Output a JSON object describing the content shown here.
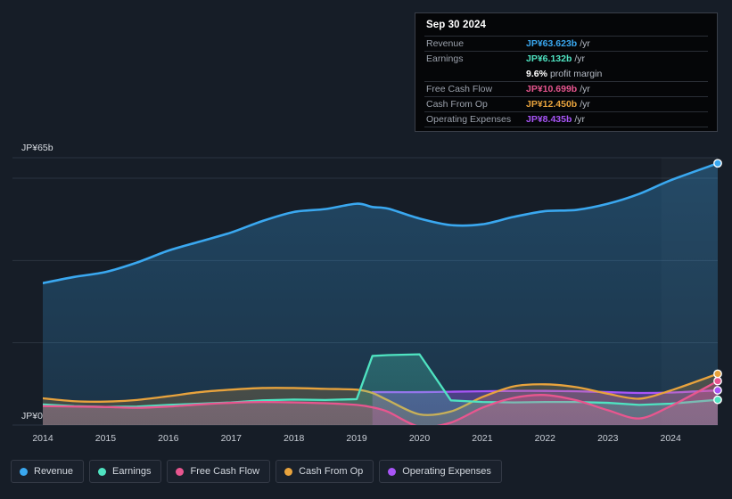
{
  "tooltip": {
    "date": "Sep 30 2024",
    "rows": [
      {
        "label": "Revenue",
        "value": "JP¥63.623b",
        "unit": "/yr",
        "color": "#3aa8f0"
      },
      {
        "label": "Earnings",
        "value": "JP¥6.132b",
        "unit": "/yr",
        "color": "#4fe3c1"
      },
      {
        "label": "Free Cash Flow",
        "value": "JP¥10.699b",
        "unit": "/yr",
        "color": "#e8568f"
      },
      {
        "label": "Cash From Op",
        "value": "JP¥12.450b",
        "unit": "/yr",
        "color": "#e8a33d"
      },
      {
        "label": "Operating Expenses",
        "value": "JP¥8.435b",
        "unit": "/yr",
        "color": "#a855f7"
      }
    ],
    "margin_value": "9.6%",
    "margin_text": "profit margin"
  },
  "axis": {
    "y_top_label": "JP¥65b",
    "y_zero_label": "JP¥0"
  },
  "legend": [
    {
      "label": "Revenue",
      "color": "#3aa8f0"
    },
    {
      "label": "Earnings",
      "color": "#4fe3c1"
    },
    {
      "label": "Free Cash Flow",
      "color": "#e8568f"
    },
    {
      "label": "Cash From Op",
      "color": "#e8a33d"
    },
    {
      "label": "Operating Expenses",
      "color": "#a855f7"
    }
  ],
  "chart_data": {
    "type": "area",
    "title": "",
    "xlabel": "",
    "ylabel": "JP¥",
    "ylim": [
      -2,
      65
    ],
    "yticks": [
      0,
      20,
      40,
      60,
      65
    ],
    "ytick_labels": [
      "JP¥0",
      "",
      "",
      "",
      "JP¥65b"
    ],
    "grid": true,
    "legend_position": "bottom-left",
    "currency": "JP¥",
    "units": "billions per year",
    "categories": [
      "2014",
      "2015",
      "2016",
      "2017",
      "2018",
      "2019",
      "2020",
      "2021",
      "2022",
      "2023",
      "2024"
    ],
    "x": [
      2014,
      2014.5,
      2015,
      2015.5,
      2016,
      2016.5,
      2017,
      2017.5,
      2018,
      2018.5,
      2019,
      2019.25,
      2019.5,
      2020,
      2020.5,
      2021,
      2021.5,
      2022,
      2022.5,
      2023,
      2023.5,
      2024,
      2024.75
    ],
    "series": [
      {
        "name": "Revenue",
        "color": "#3aa8f0",
        "values": [
          34.5,
          36.0,
          37.2,
          39.5,
          42.4,
          44.6,
          46.8,
          49.6,
          51.8,
          52.5,
          53.8,
          53.0,
          52.6,
          50.2,
          48.6,
          48.8,
          50.6,
          52.0,
          52.3,
          53.8,
          56.2,
          59.5,
          63.623
        ]
      },
      {
        "name": "Earnings",
        "color": "#4fe3c1",
        "values": [
          5.0,
          4.6,
          4.4,
          4.5,
          4.9,
          5.2,
          5.5,
          6.0,
          6.2,
          6.1,
          6.3,
          16.8,
          17.0,
          17.2,
          6.0,
          5.6,
          5.5,
          5.6,
          5.6,
          5.4,
          4.9,
          5.2,
          6.132
        ]
      },
      {
        "name": "Free Cash Flow",
        "color": "#e8568f",
        "values": [
          4.6,
          4.5,
          4.4,
          4.2,
          4.5,
          5.0,
          5.4,
          5.6,
          5.5,
          5.3,
          4.9,
          4.3,
          3.2,
          -0.4,
          0.6,
          4.2,
          6.6,
          7.3,
          6.0,
          3.6,
          1.6,
          4.6,
          10.699
        ]
      },
      {
        "name": "Cash From Op",
        "color": "#e8a33d",
        "values": [
          6.5,
          5.8,
          5.7,
          6.1,
          7.0,
          8.0,
          8.6,
          9.0,
          9.0,
          8.8,
          8.6,
          7.8,
          6.0,
          2.6,
          3.3,
          6.8,
          9.4,
          9.9,
          9.2,
          7.6,
          6.4,
          8.4,
          12.45
        ]
      },
      {
        "name": "Operating Expenses",
        "color": "#a855f7",
        "values": [
          null,
          null,
          null,
          null,
          null,
          null,
          null,
          null,
          null,
          null,
          null,
          8.0,
          8.0,
          8.0,
          8.1,
          8.2,
          8.3,
          8.3,
          8.2,
          8.0,
          7.8,
          7.9,
          8.435
        ]
      }
    ]
  }
}
